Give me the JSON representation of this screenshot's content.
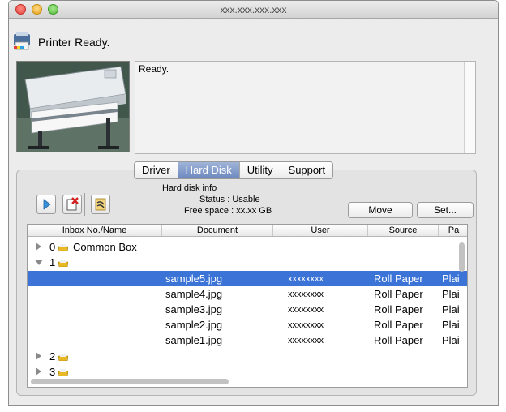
{
  "window": {
    "title": "xxx.xxx.xxx.xxx"
  },
  "status": {
    "title": "Printer Ready.",
    "message": "Ready."
  },
  "tabs": [
    {
      "label": "Driver",
      "active": false
    },
    {
      "label": "Hard Disk",
      "active": true
    },
    {
      "label": "Utility",
      "active": false
    },
    {
      "label": "Support",
      "active": false
    }
  ],
  "hard_disk": {
    "info_title": "Hard disk info",
    "status_line": "Status : Usable",
    "free_space_line": "Free space : xx.xx GB",
    "move_label": "Move",
    "set_label": "Set..."
  },
  "toolbar": {
    "icons": [
      "play-icon",
      "delete-job-icon",
      "clear-history-icon"
    ]
  },
  "list": {
    "columns": [
      "Inbox No./Name",
      "Document",
      "User",
      "Source",
      "Pa"
    ],
    "inboxes": [
      {
        "num": "0",
        "name": "Common Box"
      },
      {
        "num": "1",
        "name": ""
      },
      {
        "num": "2",
        "name": ""
      },
      {
        "num": "3",
        "name": ""
      }
    ],
    "jobs": [
      {
        "document": "sample5.jpg",
        "user": "xxxxxxxx",
        "source": "Roll Paper",
        "paper": "Plai"
      },
      {
        "document": "sample4.jpg",
        "user": "xxxxxxxx",
        "source": "Roll Paper",
        "paper": "Plai"
      },
      {
        "document": "sample3.jpg",
        "user": "xxxxxxxx",
        "source": "Roll Paper",
        "paper": "Plai"
      },
      {
        "document": "sample2.jpg",
        "user": "xxxxxxxx",
        "source": "Roll Paper",
        "paper": "Plai"
      },
      {
        "document": "sample1.jpg",
        "user": "xxxxxxxx",
        "source": "Roll Paper",
        "paper": "Plai"
      }
    ]
  },
  "colors": {
    "selection": "#3b73d7",
    "active_tab": "#6d88bf"
  }
}
